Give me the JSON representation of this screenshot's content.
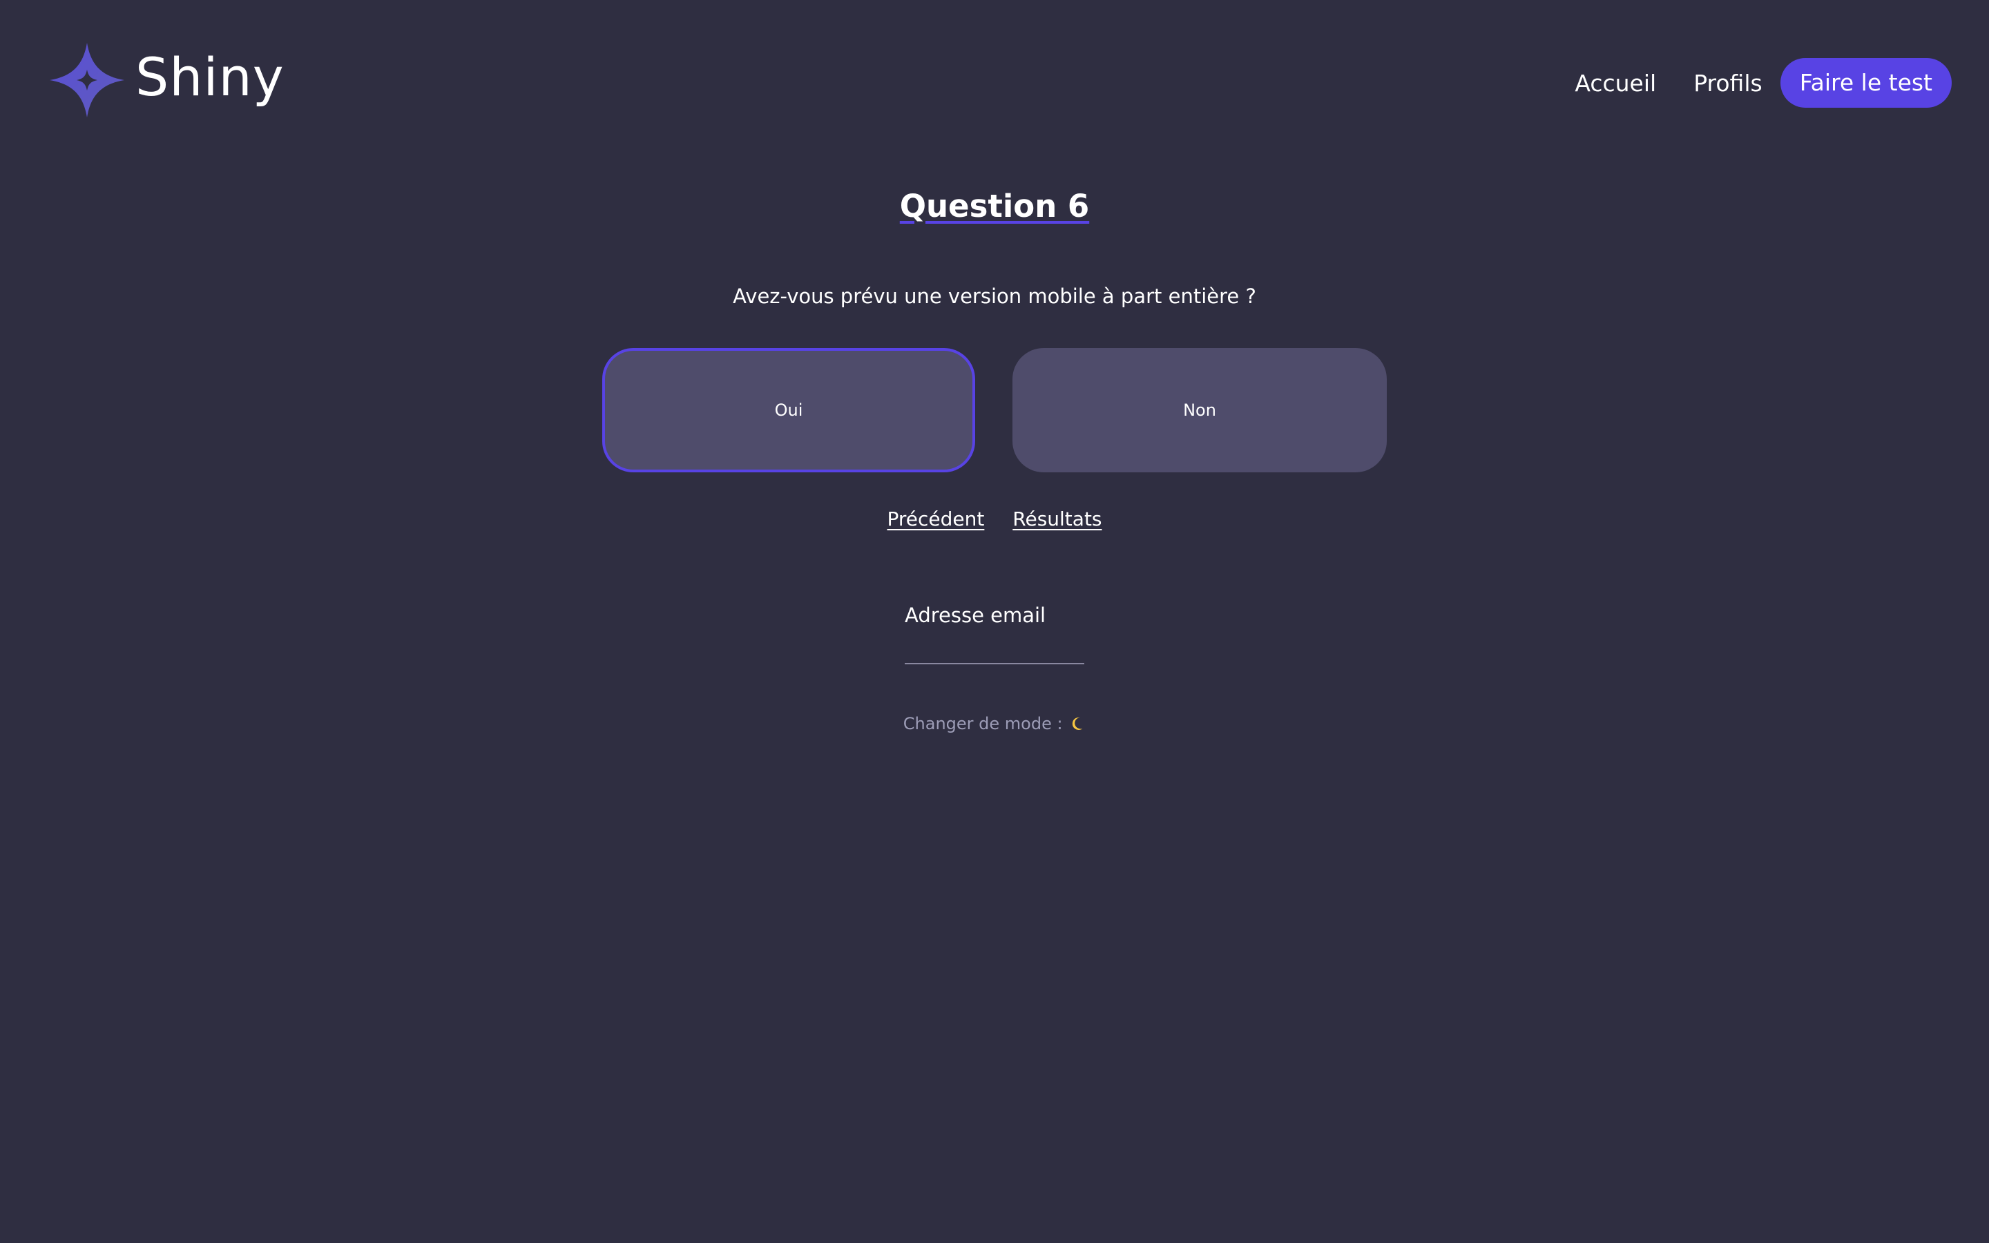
{
  "header": {
    "logo_text": "Shiny",
    "logo_icon": "sparkle-star-icon",
    "nav": {
      "home": "Accueil",
      "profiles": "Profils",
      "cta": "Faire le test"
    }
  },
  "survey": {
    "title": "Question 6",
    "question": "Avez-vous prévu une version mobile à part entière ?",
    "answers": {
      "yes": "Oui",
      "no": "Non"
    },
    "selected": "yes",
    "previous_label": "Précédent",
    "results_label": "Résultats"
  },
  "email": {
    "label": "Adresse email",
    "value": ""
  },
  "mode": {
    "label": "Changer de mode : ",
    "icon": "moon-icon"
  },
  "colors": {
    "background": "#2f2e41",
    "accent": "#5843e4",
    "answer_bg": "#4f4c6b",
    "muted_text": "#9c9cb6"
  }
}
